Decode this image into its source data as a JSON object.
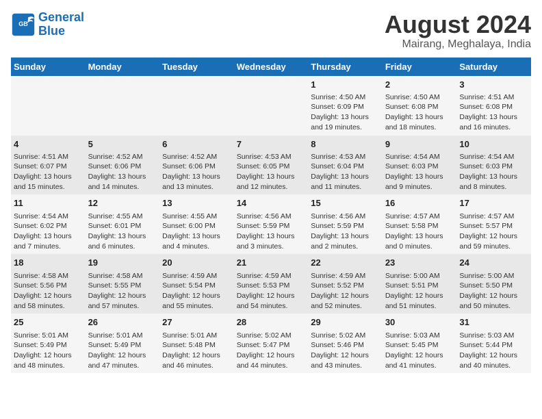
{
  "header": {
    "logo_line1": "General",
    "logo_line2": "Blue",
    "main_title": "August 2024",
    "subtitle": "Mairang, Meghalaya, India"
  },
  "days_of_week": [
    "Sunday",
    "Monday",
    "Tuesday",
    "Wednesday",
    "Thursday",
    "Friday",
    "Saturday"
  ],
  "weeks": [
    [
      {
        "day": "",
        "content": ""
      },
      {
        "day": "",
        "content": ""
      },
      {
        "day": "",
        "content": ""
      },
      {
        "day": "",
        "content": ""
      },
      {
        "day": "1",
        "content": "Sunrise: 4:50 AM\nSunset: 6:09 PM\nDaylight: 13 hours\nand 19 minutes."
      },
      {
        "day": "2",
        "content": "Sunrise: 4:50 AM\nSunset: 6:08 PM\nDaylight: 13 hours\nand 18 minutes."
      },
      {
        "day": "3",
        "content": "Sunrise: 4:51 AM\nSunset: 6:08 PM\nDaylight: 13 hours\nand 16 minutes."
      }
    ],
    [
      {
        "day": "4",
        "content": "Sunrise: 4:51 AM\nSunset: 6:07 PM\nDaylight: 13 hours\nand 15 minutes."
      },
      {
        "day": "5",
        "content": "Sunrise: 4:52 AM\nSunset: 6:06 PM\nDaylight: 13 hours\nand 14 minutes."
      },
      {
        "day": "6",
        "content": "Sunrise: 4:52 AM\nSunset: 6:06 PM\nDaylight: 13 hours\nand 13 minutes."
      },
      {
        "day": "7",
        "content": "Sunrise: 4:53 AM\nSunset: 6:05 PM\nDaylight: 13 hours\nand 12 minutes."
      },
      {
        "day": "8",
        "content": "Sunrise: 4:53 AM\nSunset: 6:04 PM\nDaylight: 13 hours\nand 11 minutes."
      },
      {
        "day": "9",
        "content": "Sunrise: 4:54 AM\nSunset: 6:03 PM\nDaylight: 13 hours\nand 9 minutes."
      },
      {
        "day": "10",
        "content": "Sunrise: 4:54 AM\nSunset: 6:03 PM\nDaylight: 13 hours\nand 8 minutes."
      }
    ],
    [
      {
        "day": "11",
        "content": "Sunrise: 4:54 AM\nSunset: 6:02 PM\nDaylight: 13 hours\nand 7 minutes."
      },
      {
        "day": "12",
        "content": "Sunrise: 4:55 AM\nSunset: 6:01 PM\nDaylight: 13 hours\nand 6 minutes."
      },
      {
        "day": "13",
        "content": "Sunrise: 4:55 AM\nSunset: 6:00 PM\nDaylight: 13 hours\nand 4 minutes."
      },
      {
        "day": "14",
        "content": "Sunrise: 4:56 AM\nSunset: 5:59 PM\nDaylight: 13 hours\nand 3 minutes."
      },
      {
        "day": "15",
        "content": "Sunrise: 4:56 AM\nSunset: 5:59 PM\nDaylight: 13 hours\nand 2 minutes."
      },
      {
        "day": "16",
        "content": "Sunrise: 4:57 AM\nSunset: 5:58 PM\nDaylight: 13 hours\nand 0 minutes."
      },
      {
        "day": "17",
        "content": "Sunrise: 4:57 AM\nSunset: 5:57 PM\nDaylight: 12 hours\nand 59 minutes."
      }
    ],
    [
      {
        "day": "18",
        "content": "Sunrise: 4:58 AM\nSunset: 5:56 PM\nDaylight: 12 hours\nand 58 minutes."
      },
      {
        "day": "19",
        "content": "Sunrise: 4:58 AM\nSunset: 5:55 PM\nDaylight: 12 hours\nand 57 minutes."
      },
      {
        "day": "20",
        "content": "Sunrise: 4:59 AM\nSunset: 5:54 PM\nDaylight: 12 hours\nand 55 minutes."
      },
      {
        "day": "21",
        "content": "Sunrise: 4:59 AM\nSunset: 5:53 PM\nDaylight: 12 hours\nand 54 minutes."
      },
      {
        "day": "22",
        "content": "Sunrise: 4:59 AM\nSunset: 5:52 PM\nDaylight: 12 hours\nand 52 minutes."
      },
      {
        "day": "23",
        "content": "Sunrise: 5:00 AM\nSunset: 5:51 PM\nDaylight: 12 hours\nand 51 minutes."
      },
      {
        "day": "24",
        "content": "Sunrise: 5:00 AM\nSunset: 5:50 PM\nDaylight: 12 hours\nand 50 minutes."
      }
    ],
    [
      {
        "day": "25",
        "content": "Sunrise: 5:01 AM\nSunset: 5:49 PM\nDaylight: 12 hours\nand 48 minutes."
      },
      {
        "day": "26",
        "content": "Sunrise: 5:01 AM\nSunset: 5:49 PM\nDaylight: 12 hours\nand 47 minutes."
      },
      {
        "day": "27",
        "content": "Sunrise: 5:01 AM\nSunset: 5:48 PM\nDaylight: 12 hours\nand 46 minutes."
      },
      {
        "day": "28",
        "content": "Sunrise: 5:02 AM\nSunset: 5:47 PM\nDaylight: 12 hours\nand 44 minutes."
      },
      {
        "day": "29",
        "content": "Sunrise: 5:02 AM\nSunset: 5:46 PM\nDaylight: 12 hours\nand 43 minutes."
      },
      {
        "day": "30",
        "content": "Sunrise: 5:03 AM\nSunset: 5:45 PM\nDaylight: 12 hours\nand 41 minutes."
      },
      {
        "day": "31",
        "content": "Sunrise: 5:03 AM\nSunset: 5:44 PM\nDaylight: 12 hours\nand 40 minutes."
      }
    ]
  ]
}
